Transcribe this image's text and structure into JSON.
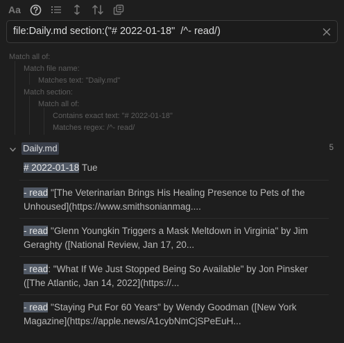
{
  "toolbar": {
    "buttons": [
      {
        "name": "match-case-icon",
        "label": "Aa"
      },
      {
        "name": "explain-query-icon"
      },
      {
        "name": "collapse-results-icon"
      },
      {
        "name": "show-more-context-icon"
      },
      {
        "name": "sort-order-icon"
      },
      {
        "name": "copy-results-icon"
      }
    ]
  },
  "search": {
    "value": "file:Daily.md section:(\"# 2022-01-18\"  /^- read/)"
  },
  "explanation": [
    {
      "text": "Match all of:"
    },
    {
      "text": "Match file name:"
    },
    {
      "text": "Matches text: \"Daily.md\""
    },
    {
      "text": "Match section:"
    },
    {
      "text": "Match all of:"
    },
    {
      "text": "Contains exact text: \"# 2022-01-18\""
    },
    {
      "text": "Matches regex: /^- read/"
    }
  ],
  "file": {
    "name": "Daily.md",
    "count": "5"
  },
  "results": [
    {
      "highlight": "# 2022-01-18",
      "rest": " Tue"
    },
    {
      "highlight": "- read",
      "rest": " \"[The Veterinarian Brings His Healing Presence to Pets of the Unhoused](https://www.smithsonianmag...."
    },
    {
      "highlight": "- read",
      "rest": " \"Glenn Youngkin Triggers a Mask Meltdown in Virginia\" by Jim Geraghty ([National Review, Jan 17, 20..."
    },
    {
      "highlight": "- read",
      "rest": ": \"What If We Just Stopped Being So Available\" by Jon Pinsker ([The Atlantic, Jan 14, 2022](https://..."
    },
    {
      "highlight": "- read",
      "rest": " \"Staying Put For 60 Years\" by Wendy Goodman ([New York Magazine](https://apple.news/A1cybNmCjSPeEuH..."
    }
  ],
  "colors": {
    "background": "#1e1e1e",
    "highlight": "#525a66",
    "muted_text": "#5d5d5d"
  }
}
